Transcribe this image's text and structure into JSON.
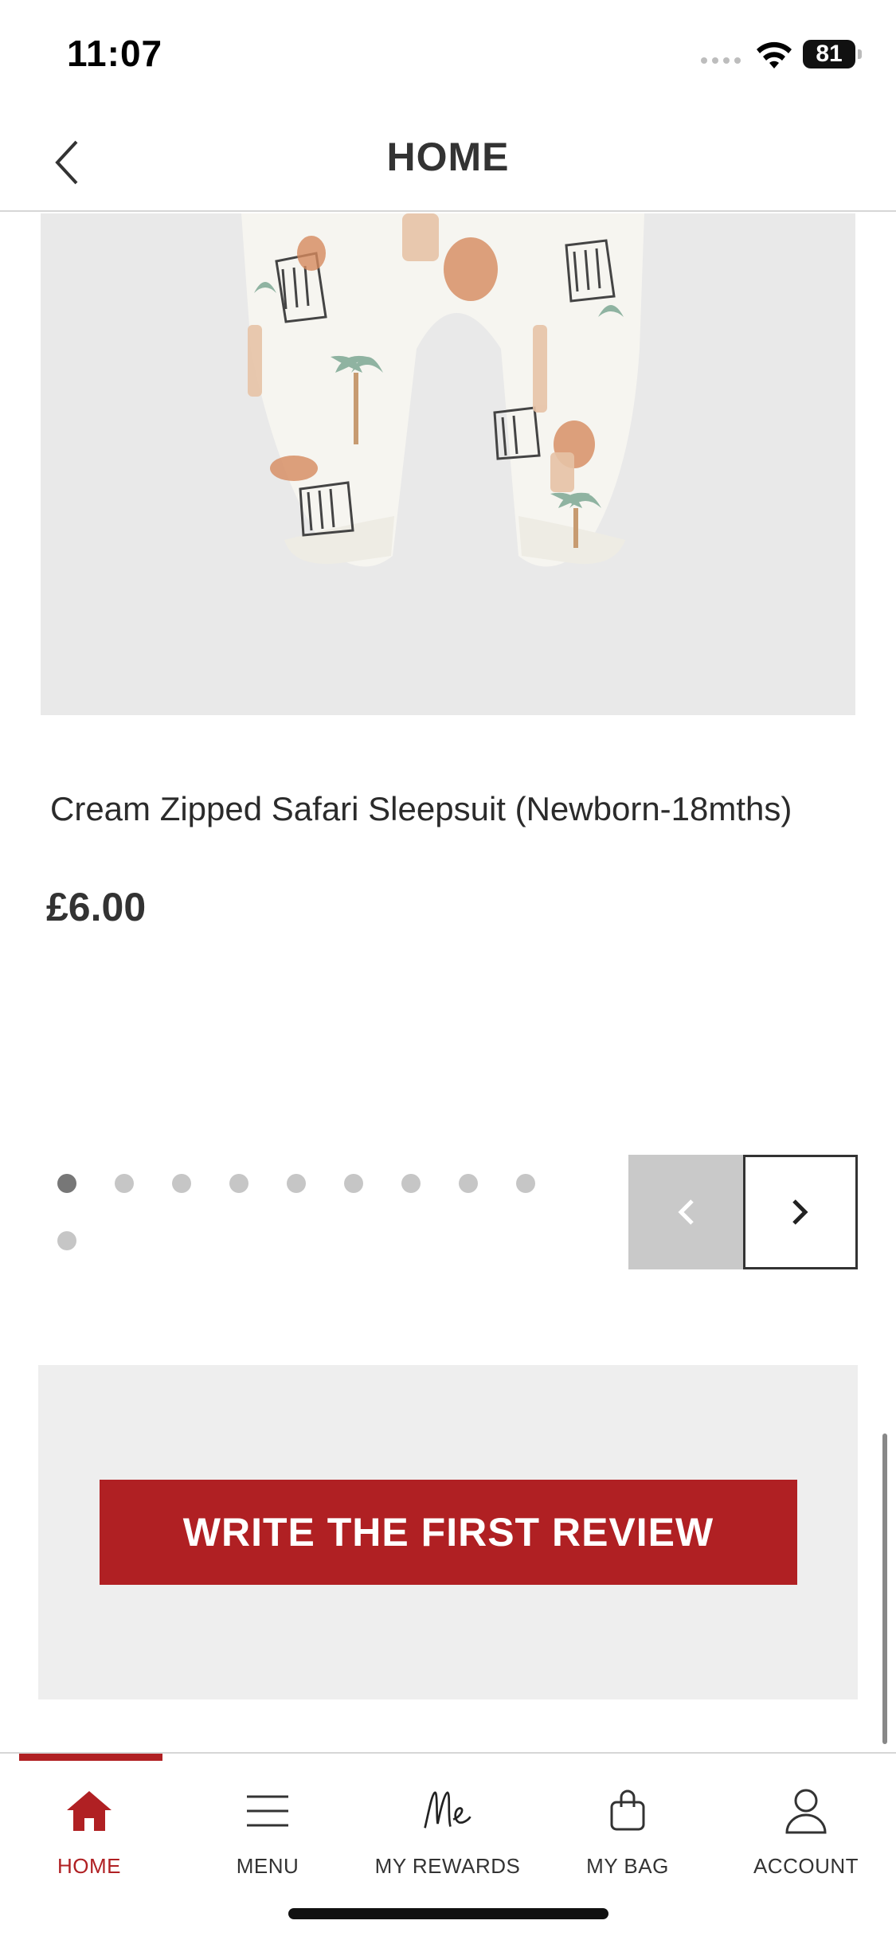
{
  "status_bar": {
    "time": "11:07",
    "battery": "81"
  },
  "header": {
    "title": "HOME",
    "back_icon": "chevron-left-icon"
  },
  "product": {
    "name": "Cream Zipped Safari Sleepsuit (Newborn-18mths)",
    "price": "£6.00"
  },
  "carousel": {
    "total_dots": 10,
    "active_index": 0
  },
  "review": {
    "button_label": "WRITE THE FIRST REVIEW"
  },
  "nav": {
    "items": [
      {
        "label": "HOME",
        "icon": "home-icon"
      },
      {
        "label": "MENU",
        "icon": "menu-icon"
      },
      {
        "label": "MY REWARDS",
        "icon": "rewards-me-icon"
      },
      {
        "label": "MY BAG",
        "icon": "bag-icon"
      },
      {
        "label": "ACCOUNT",
        "icon": "account-icon"
      }
    ],
    "active": "HOME"
  },
  "colors": {
    "accent": "#b02023",
    "image_bg": "#e9e9e9",
    "review_bg": "#eeeeee"
  }
}
